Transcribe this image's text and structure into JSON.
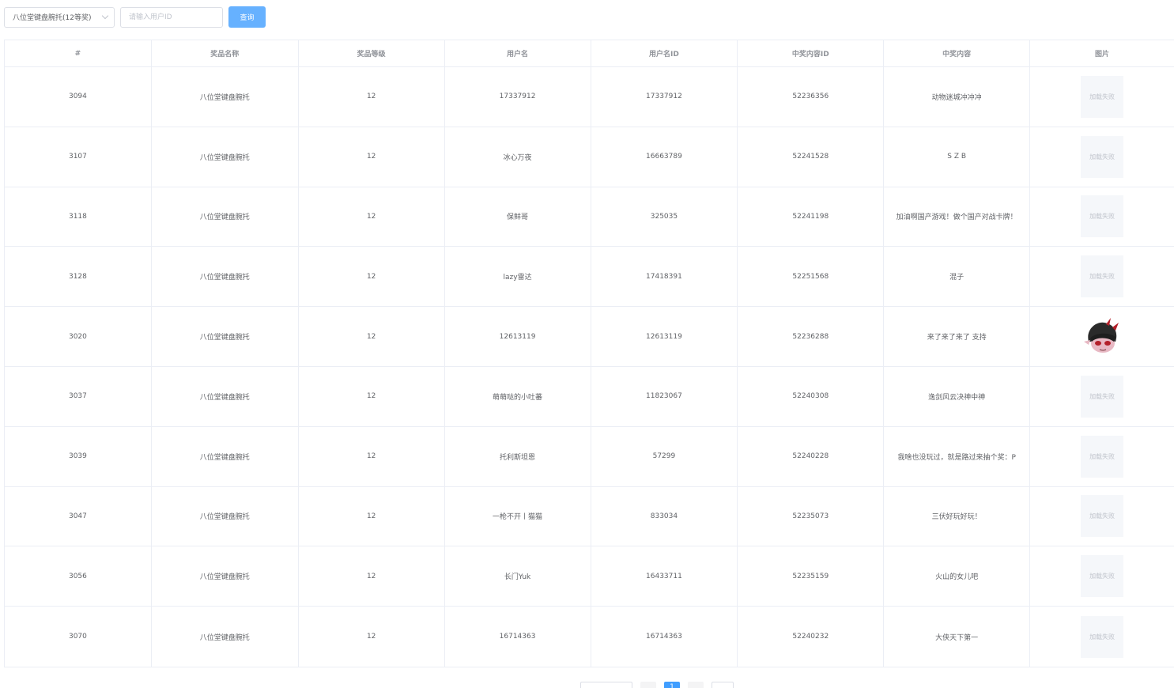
{
  "filter": {
    "prize_select": "八位堂键盘腕托(12等奖)",
    "user_id_placeholder": "请输入用户ID",
    "query_label": "查询"
  },
  "table": {
    "columns": [
      "#",
      "奖品名称",
      "奖品等级",
      "用户名",
      "用户名ID",
      "中奖内容ID",
      "中奖内容",
      "图片"
    ],
    "image_fail_text": "加载失败",
    "rows": [
      {
        "id": "3094",
        "prize": "八位堂键盘腕托",
        "level": "12",
        "username": "17337912",
        "user_id": "17337912",
        "content_id": "52236356",
        "content": "动物迷城冲冲冲",
        "image": "fail"
      },
      {
        "id": "3107",
        "prize": "八位堂键盘腕托",
        "level": "12",
        "username": "冰心万夜",
        "user_id": "16663789",
        "content_id": "52241528",
        "content": "S Z B",
        "image": "fail"
      },
      {
        "id": "3118",
        "prize": "八位堂键盘腕托",
        "level": "12",
        "username": "保鲜哥",
        "user_id": "325035",
        "content_id": "52241198",
        "content": "加油啊国产游戏！做个国产对战卡牌！",
        "image": "fail"
      },
      {
        "id": "3128",
        "prize": "八位堂键盘腕托",
        "level": "12",
        "username": "lazy雷达",
        "user_id": "17418391",
        "content_id": "52251568",
        "content": "混子",
        "image": "fail"
      },
      {
        "id": "3020",
        "prize": "八位堂键盘腕托",
        "level": "12",
        "username": "12613119",
        "user_id": "12613119",
        "content_id": "52236288",
        "content": "来了来了来了 支持",
        "image": "avatar"
      },
      {
        "id": "3037",
        "prize": "八位堂键盘腕托",
        "level": "12",
        "username": "萌萌哒的小吐蕃",
        "user_id": "11823067",
        "content_id": "52240308",
        "content": "逸剑风云决神中神",
        "image": "fail"
      },
      {
        "id": "3039",
        "prize": "八位堂键盘腕托",
        "level": "12",
        "username": "托利斯坦恩",
        "user_id": "57299",
        "content_id": "52240228",
        "content": "我啥也没玩过，就是路过来抽个奖：P",
        "image": "fail"
      },
      {
        "id": "3047",
        "prize": "八位堂键盘腕托",
        "level": "12",
        "username": "一枪不开丨猫猫",
        "user_id": "833034",
        "content_id": "52235073",
        "content": "三伏好玩好玩！",
        "image": "fail"
      },
      {
        "id": "3056",
        "prize": "八位堂键盘腕托",
        "level": "12",
        "username": "长门Yuk",
        "user_id": "16433711",
        "content_id": "52235159",
        "content": "火山的女儿吧",
        "image": "fail"
      },
      {
        "id": "3070",
        "prize": "八位堂键盘腕托",
        "level": "12",
        "username": "16714363",
        "user_id": "16714363",
        "content_id": "52240232",
        "content": "大侠天下第一",
        "image": "fail"
      }
    ]
  },
  "pagination": {
    "current_page": "1"
  }
}
